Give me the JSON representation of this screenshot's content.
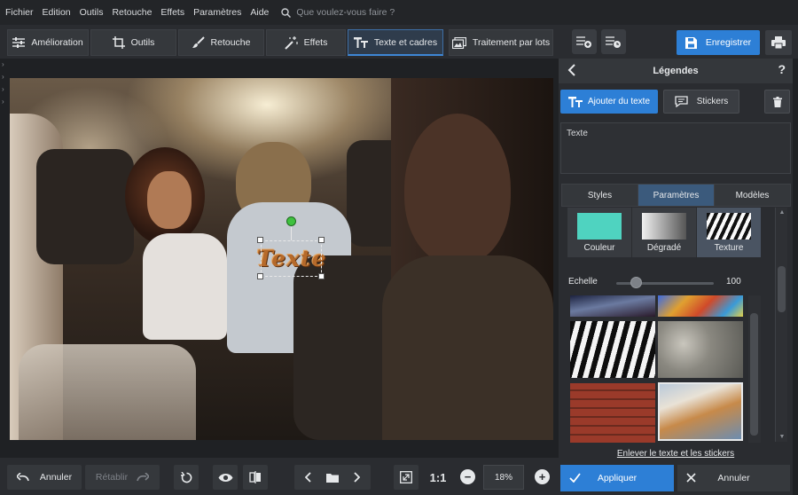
{
  "menu": {
    "items": [
      "Fichier",
      "Edition",
      "Outils",
      "Retouche",
      "Effets",
      "Paramètres",
      "Aide"
    ],
    "search_placeholder": "Que voulez-vous faire ?"
  },
  "tabs": {
    "amelioration": "Amélioration",
    "outils": "Outils",
    "retouche": "Retouche",
    "effets": "Effets",
    "texte_cadres": "Texte et cadres",
    "traitement": "Traitement par lots",
    "active": "Texte et cadres"
  },
  "toolbar": {
    "save_label": "Enregistrer"
  },
  "canvas": {
    "text_layer": "Texte"
  },
  "panel": {
    "title": "Légendes",
    "help": "?",
    "add_text_label": "Ajouter du texte",
    "stickers_label": "Stickers",
    "text_content": "Texte",
    "subtabs": [
      "Styles",
      "Paramètres",
      "Modèles"
    ],
    "active_subtab": "Paramètres",
    "fill_options": [
      "Couleur",
      "Dégradé",
      "Texture"
    ],
    "selected_fill": "Texture",
    "scale_label": "Echelle",
    "scale_value": "100",
    "scale_level": 0.2,
    "remove_link": "Enlever le texte et les stickers",
    "apply_label": "Appliquer",
    "cancel_label": "Annuler",
    "colors": {
      "couleur_swatch": "#4fd3c0",
      "accent": "#2d7fd6"
    }
  },
  "bottom": {
    "undo_label": "Annuler",
    "redo_label": "Rétablir",
    "ratio_label": "1:1",
    "zoom_value": "18%"
  }
}
